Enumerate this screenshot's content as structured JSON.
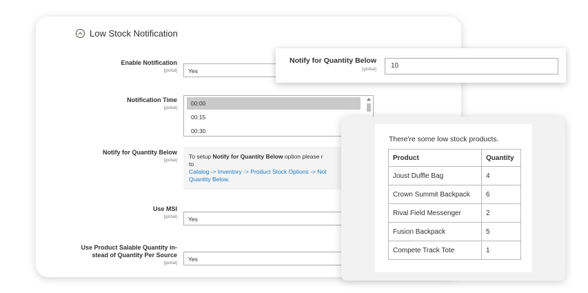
{
  "section": {
    "title": "Low Stock Notification"
  },
  "fields": {
    "enable_notification": {
      "label": "Enable Notification",
      "scope": "[global]",
      "value": "Yes"
    },
    "notification_time": {
      "label": "Notification Time",
      "scope": "[global]",
      "options": [
        "00:00",
        "00:15",
        "00:30"
      ],
      "selected": "00:00"
    },
    "notify_qty": {
      "label": "Notify for Quantity Below",
      "scope": "[global]",
      "note_prefix": "To setup ",
      "note_bold": "Notify for Quantity Below",
      "note_suffix": " option please r",
      "note_to": "to",
      "note_link": "Catalog -> Inventory -> Product Stock Options -> Not",
      "note_link2": "Quantity Below."
    },
    "use_msi": {
      "label": "Use MSI",
      "scope": "[global]",
      "value": "Yes"
    },
    "use_salable": {
      "label_line1": "Use Product Salable Quantity in-",
      "label_line2": "stead of Quantity Per Source",
      "scope": "[global]",
      "value": "Yes"
    }
  },
  "notify_popup": {
    "label": "Notify for Quantity Below",
    "scope": "[global]",
    "value": "10"
  },
  "email": {
    "intro": "There're some low stock products.",
    "columns": [
      "Product",
      "Quantity"
    ],
    "rows": [
      {
        "product": "Joust Duffle Bag",
        "qty": "4"
      },
      {
        "product": "Crown Summit Backpack",
        "qty": "6"
      },
      {
        "product": "Rival Field Messenger",
        "qty": "2"
      },
      {
        "product": "Fusion Backpack",
        "qty": "5"
      },
      {
        "product": "Compete Track Tote",
        "qty": "1"
      }
    ]
  }
}
